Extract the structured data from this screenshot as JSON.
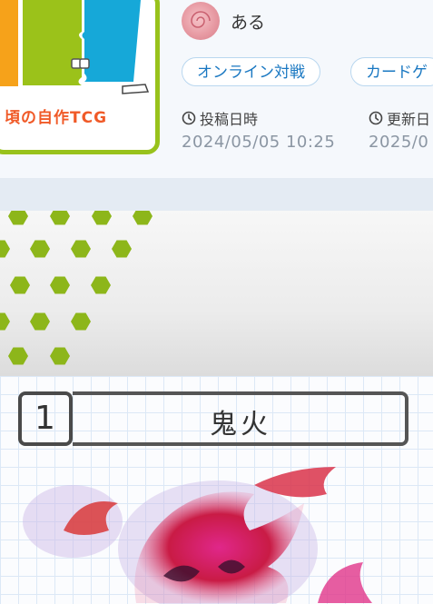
{
  "thumbnail": {
    "caption": "頃の自作TCG"
  },
  "user": {
    "name": "ある"
  },
  "tags": [
    {
      "label": "オンライン対戦"
    },
    {
      "label": "カードゲ"
    }
  ],
  "meta": {
    "posted_label": "投稿日時",
    "posted_value": "2024/05/05 10:25",
    "updated_label": "更新日",
    "updated_value": "2025/0"
  },
  "card": {
    "number": "1",
    "name": "鬼火"
  },
  "colors": {
    "accent": "#1a78c2",
    "thumb_border": "#98c21c",
    "hex_green": "#8db61a"
  },
  "icons": [
    "clock-icon",
    "avatar-rose"
  ]
}
